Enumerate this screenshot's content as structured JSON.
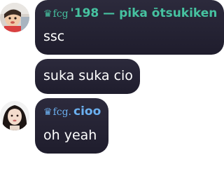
{
  "messages": [
    {
      "author": {
        "crown": "♛",
        "tag": "fcg",
        "name": "'198 — pika ōtsukiken",
        "color": "#46c2a0"
      },
      "lines": [
        "ssc",
        "suka suka cio"
      ]
    },
    {
      "author": {
        "crown": "♛",
        "tag": "fcg.",
        "name": "cioo",
        "color": "#6bb0f0"
      },
      "lines": [
        "oh yeah"
      ]
    }
  ],
  "colors": {
    "bubble": "#23212f",
    "text": "#ffffff"
  }
}
